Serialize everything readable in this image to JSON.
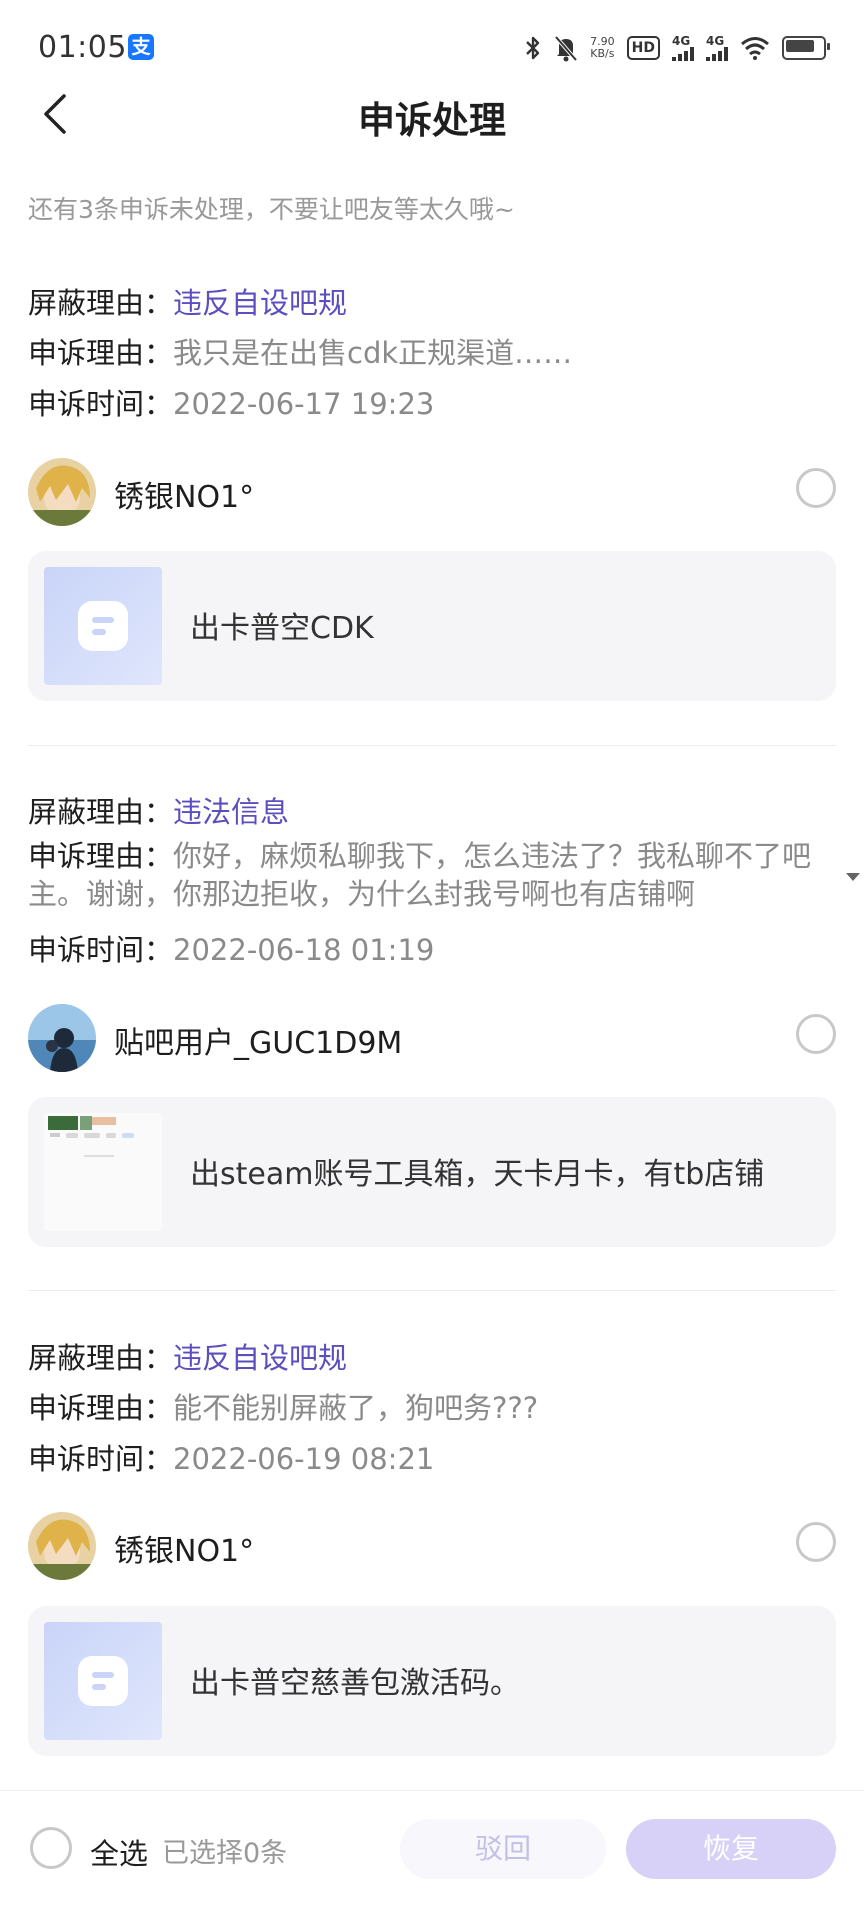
{
  "status_bar": {
    "time": "01:05",
    "speed_value": "7.90",
    "speed_unit": "KB/s",
    "hd_label": "HD",
    "signal_1": "4G",
    "signal_2": "4G"
  },
  "header": {
    "title": "申诉处理"
  },
  "notice": "还有3条申诉未处理，不要让吧友等太久哦~",
  "labels": {
    "block_reason": "屏蔽理由：",
    "appeal_reason": "申诉理由：",
    "appeal_time": "申诉时间："
  },
  "appeals": [
    {
      "block_reason": "违反自设吧规",
      "appeal_reason": "我只是在出售cdk正规渠道……",
      "appeal_time": "2022-06-17 19:23",
      "user_name": "锈银NO1°",
      "post_title": "出卡普空CDK"
    },
    {
      "block_reason": "违法信息",
      "appeal_reason": "你好，麻烦私聊我下，怎么违法了？我私聊不了吧主。谢谢，你那边拒收，为什么封我号啊也有店铺啊",
      "appeal_time": "2022-06-18 01:19",
      "user_name": "贴吧用户_GUC1D9M",
      "post_title": "出steam账号工具箱，天卡月卡，有tb店铺"
    },
    {
      "block_reason": "违反自设吧规",
      "appeal_reason": "能不能别屏蔽了，狗吧务???",
      "appeal_time": "2022-06-19 08:21",
      "user_name": "锈银NO1°",
      "post_title": "出卡普空慈善包激活码。"
    }
  ],
  "bottom_bar": {
    "select_all": "全选",
    "selected_count": "已选择0条",
    "reject": "驳回",
    "restore": "恢复"
  },
  "colors": {
    "accent": "#5b4fbf",
    "restore_button": "#d8d1f7",
    "reject_text": "#c3c0e6"
  }
}
